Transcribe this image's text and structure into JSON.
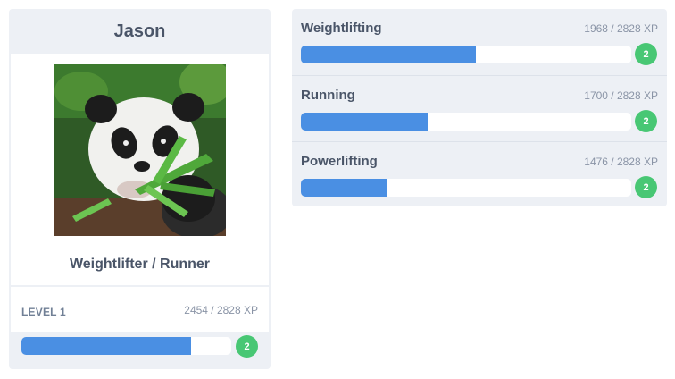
{
  "profile": {
    "name": "Jason",
    "avatar_alt": "panda-photo",
    "title": "Weightlifter / Runner",
    "level_label": "LEVEL 1",
    "xp_text": "2454 / 2828 XP",
    "progress": 0.81,
    "badge": "2"
  },
  "skills": [
    {
      "name": "Weightlifting",
      "xp_text": "1968 / 2828 XP",
      "progress": 0.53,
      "badge": "2"
    },
    {
      "name": "Running",
      "xp_text": "1700 / 2828 XP",
      "progress": 0.385,
      "badge": "2"
    },
    {
      "name": "Powerlifting",
      "xp_text": "1476 / 2828 XP",
      "progress": 0.26,
      "badge": "2"
    }
  ],
  "colors": {
    "card_bg": "#edf0f5",
    "bar_fill": "#4a8fe3",
    "badge": "#48c774",
    "text": "#4a5568",
    "muted": "#8a94a6"
  }
}
